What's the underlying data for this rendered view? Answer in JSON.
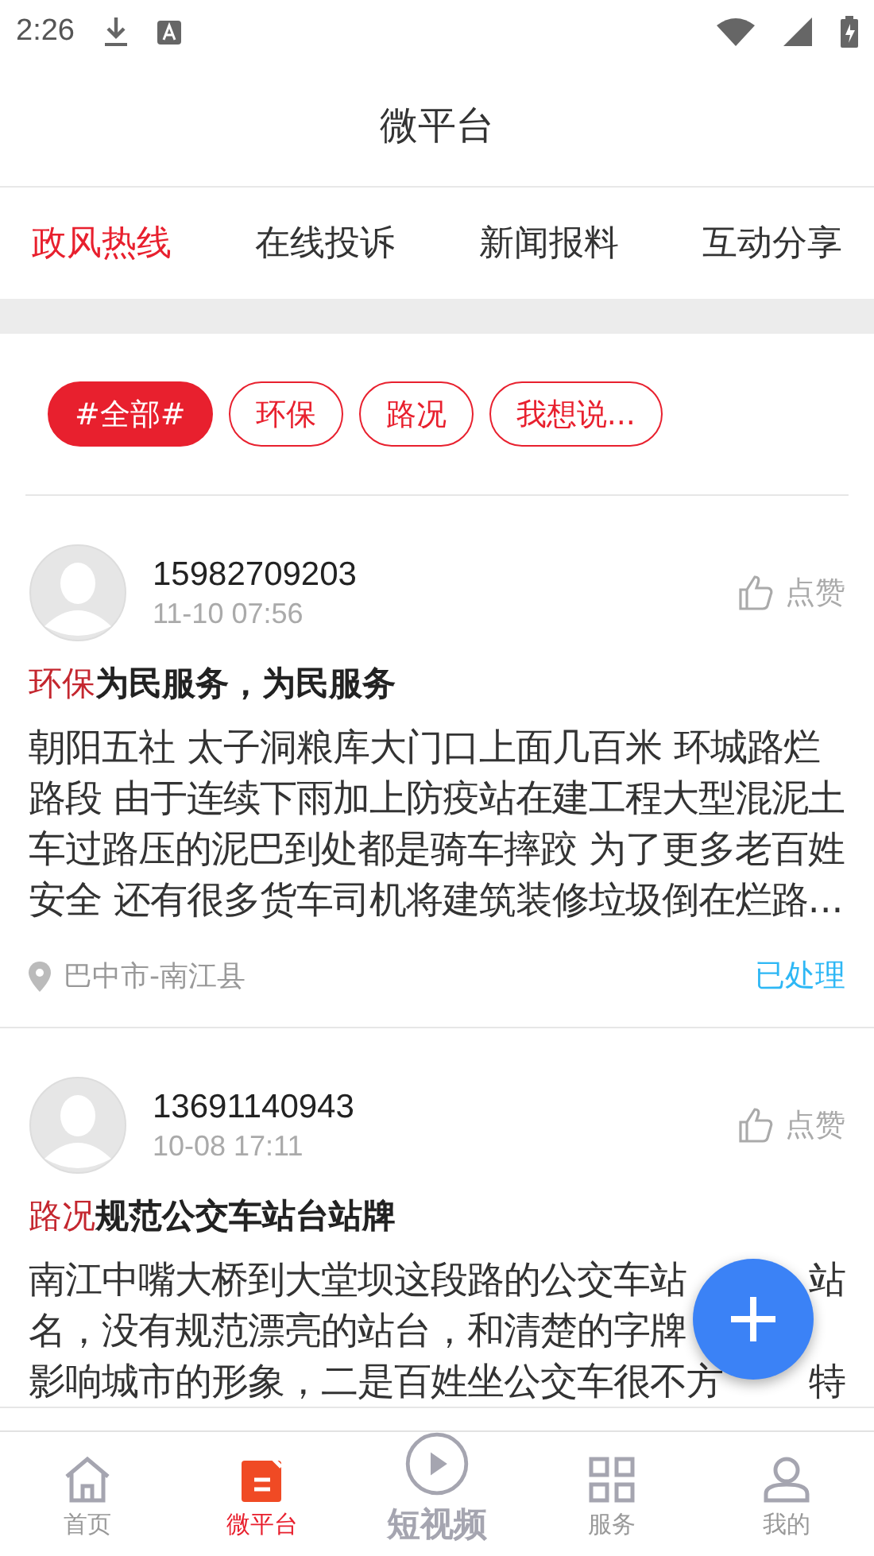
{
  "status_bar": {
    "time": "2:26"
  },
  "header": {
    "title": "微平台"
  },
  "tabs": [
    {
      "label": "政风热线",
      "selected": true
    },
    {
      "label": "在线投诉",
      "selected": false
    },
    {
      "label": "新闻报料",
      "selected": false
    },
    {
      "label": "互动分享",
      "selected": false
    }
  ],
  "filters": [
    {
      "label": "#全部#",
      "selected": true
    },
    {
      "label": "环保",
      "selected": false
    },
    {
      "label": "路况",
      "selected": false
    },
    {
      "label": "我想说...",
      "selected": false
    }
  ],
  "posts": [
    {
      "user": "15982709203",
      "time": "11-10 07:56",
      "like_label": "点赞",
      "category": "环保",
      "title": "为民服务，为民服务",
      "body": "朝阳五社 太子洞粮库大门口上面几百米 环城路烂路段 由于连续下雨加上防疫站在建工程大型混泥土车过路压的泥巴到处都是骑车摔跤 为了更多老百姓安全  还有很多货车司机将建筑装修垃圾倒在烂路...",
      "location": "巴中市-南江县",
      "status": "已处理"
    },
    {
      "user": "13691140943",
      "time": "10-08 17:11",
      "like_label": "点赞",
      "category": "路况",
      "title": "规范公交车站台站牌",
      "body_lines": [
        {
          "left": "南江中嘴大桥到大堂坝这段路的公交车站",
          "right": "站"
        },
        {
          "left": "名，没有规范漂亮的站台，和清楚的字牌"
        },
        {
          "left": "影响城市的形象，二是百姓坐公交车很不方",
          "right": "特"
        }
      ]
    }
  ],
  "bottom_nav": [
    {
      "kind": "home",
      "label": "首页",
      "selected": false
    },
    {
      "kind": "platform",
      "label": "微平台",
      "selected": true
    },
    {
      "kind": "video",
      "label": "短视频",
      "selected": false
    },
    {
      "kind": "services",
      "label": "服务",
      "selected": false
    },
    {
      "kind": "profile",
      "label": "我的",
      "selected": false
    }
  ]
}
